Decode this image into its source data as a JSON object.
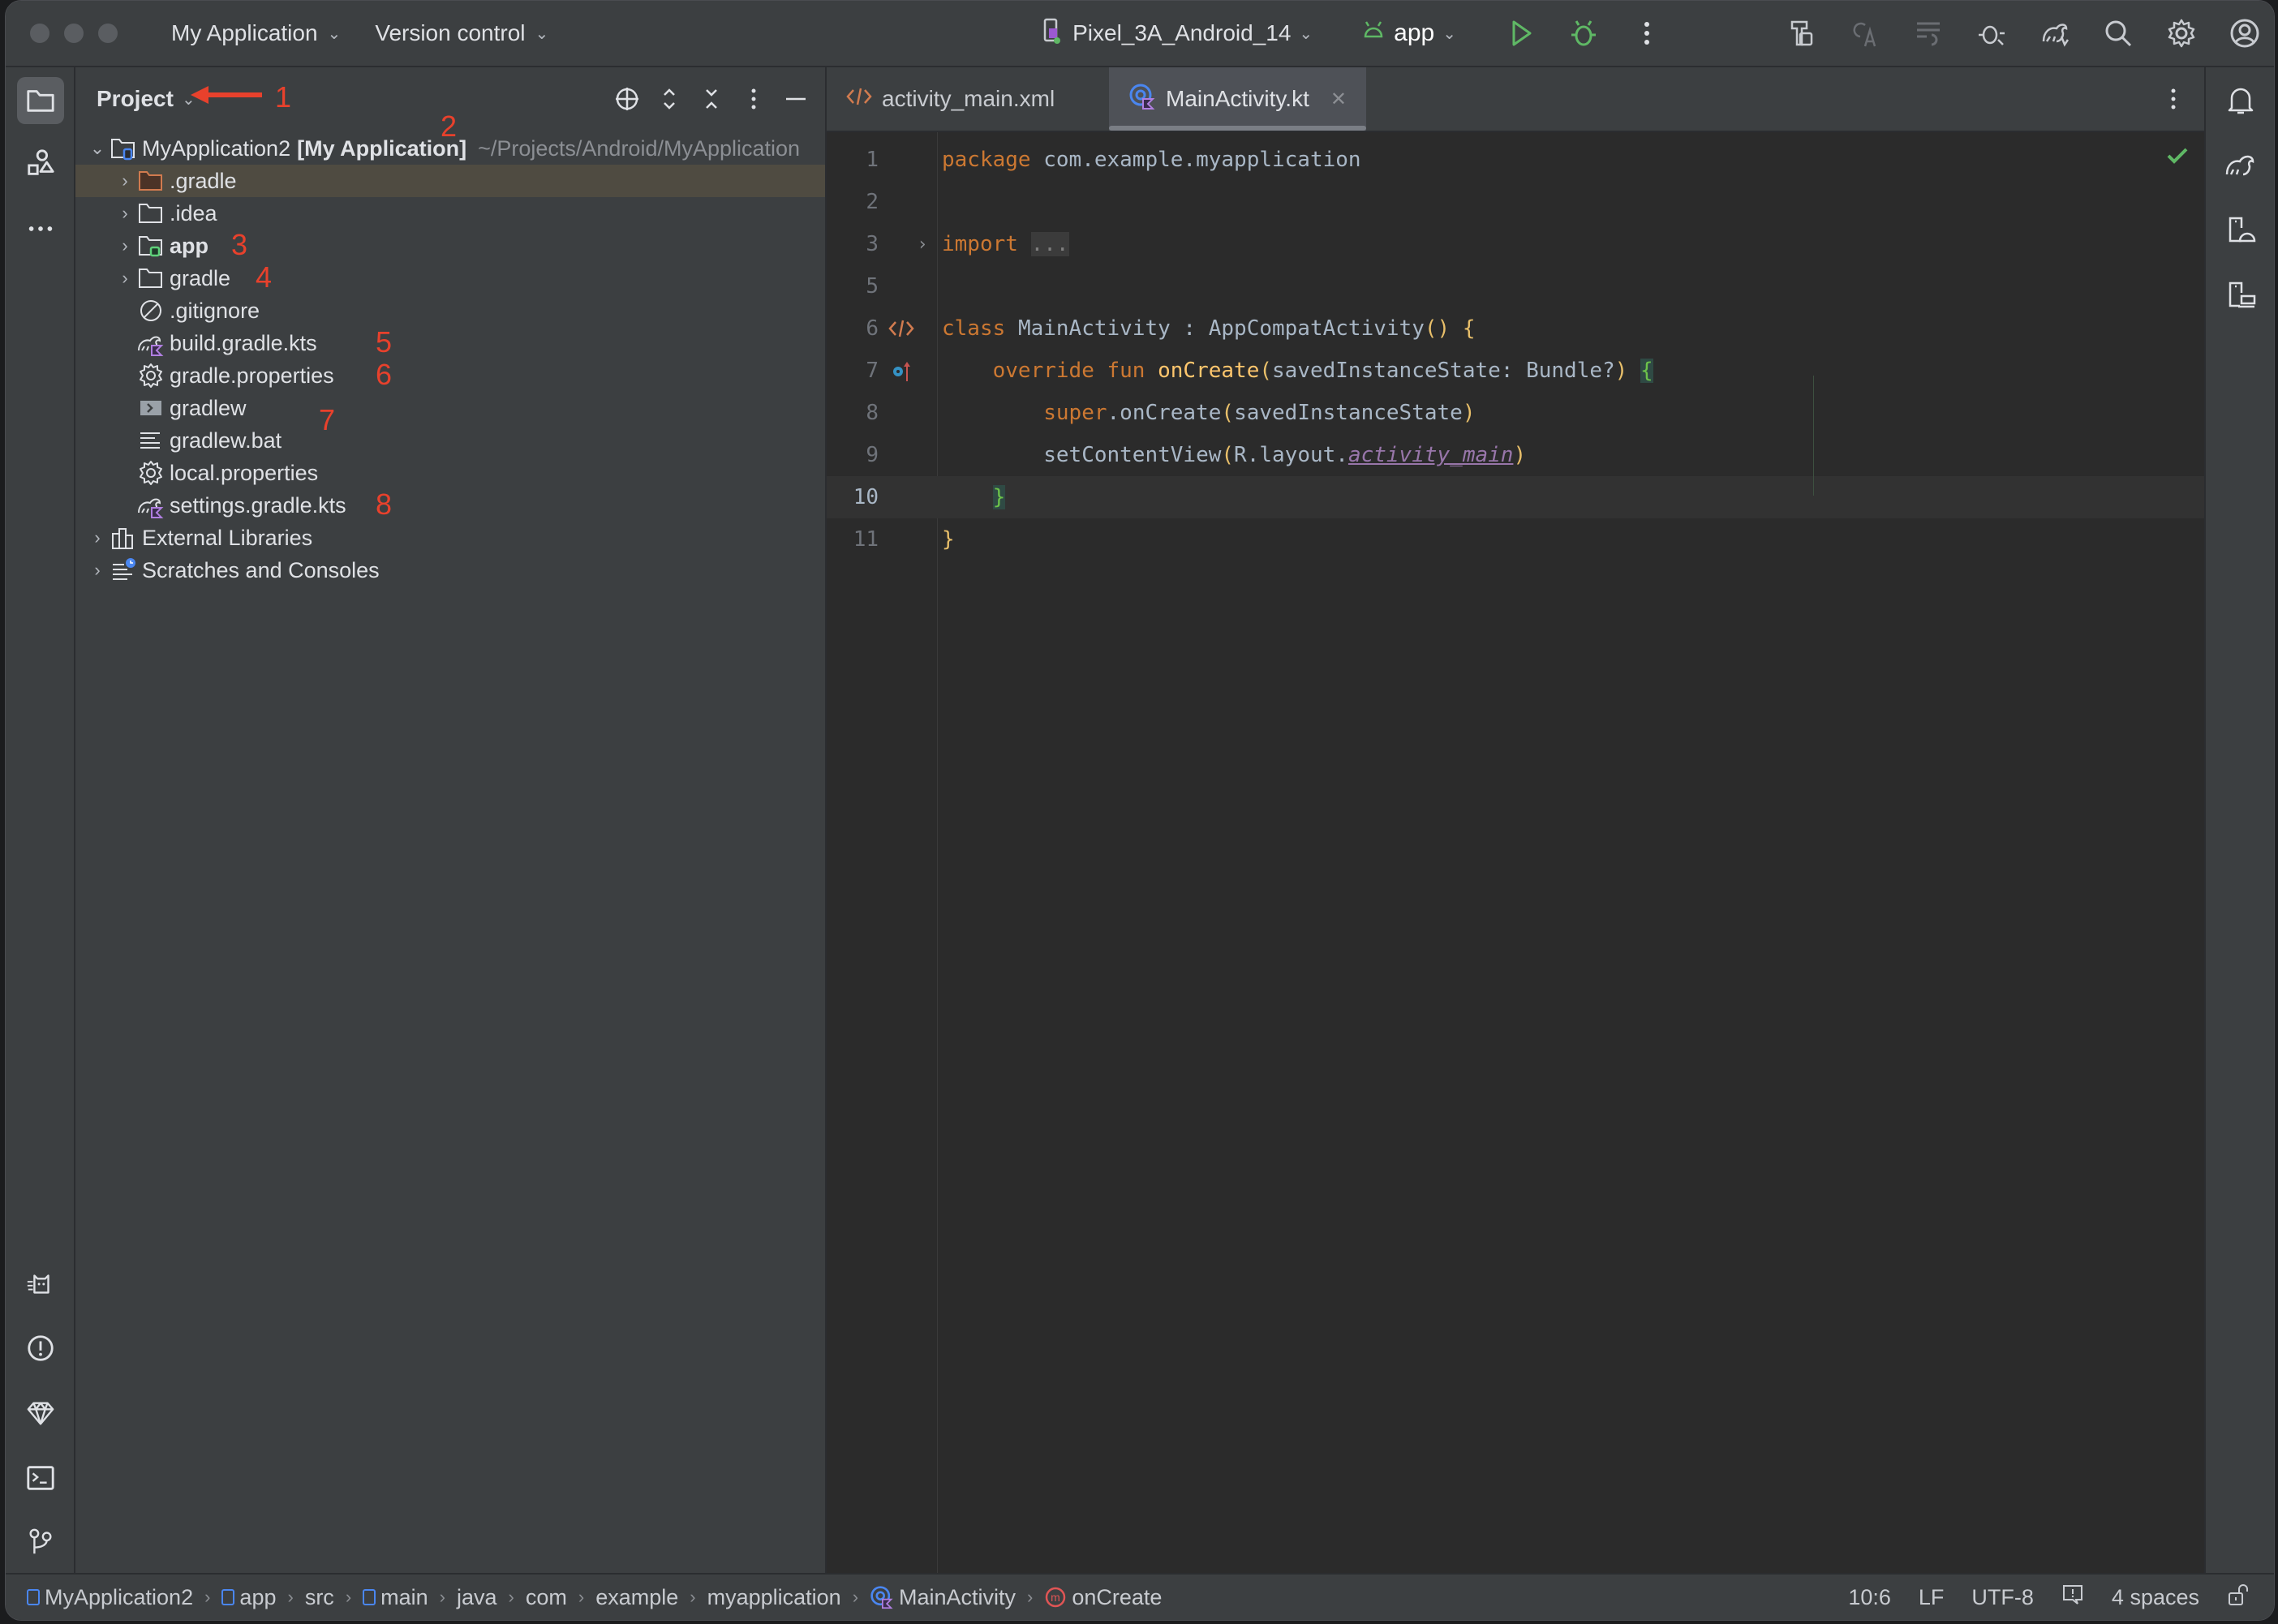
{
  "titlebar": {
    "project_menu": "My Application",
    "vcs_menu": "Version control",
    "device": "Pixel_3A_Android_14",
    "run_config": "app",
    "icons": [
      "run-icon",
      "debug-icon",
      "more-icon",
      "build-icon",
      "translate-icon",
      "sync-diff-icon",
      "profile-icon",
      "gradle-sync-icon",
      "search-icon",
      "settings-icon",
      "account-icon"
    ]
  },
  "left_strip": {
    "top": [
      "folder-icon",
      "structure-icon",
      "more-icon"
    ],
    "bottom": [
      "logcat-icon",
      "problems-icon",
      "gemini-icon",
      "terminal-icon",
      "git-icon"
    ]
  },
  "project_panel": {
    "title": "Project",
    "actions": [
      "locate-icon",
      "expand-all-icon",
      "collapse-all-icon",
      "options-icon",
      "hide-icon"
    ],
    "root": {
      "name": "MyApplication2",
      "module": "[My Application]",
      "path": "~/Projects/Android/MyApplication"
    },
    "items": [
      {
        "label": ".gradle",
        "icon": "folder-excluded",
        "expandable": true,
        "selected": true
      },
      {
        "label": ".idea",
        "icon": "folder",
        "expandable": true
      },
      {
        "label": "app",
        "icon": "module-folder",
        "expandable": true,
        "bold": true
      },
      {
        "label": "gradle",
        "icon": "folder",
        "expandable": true
      },
      {
        "label": ".gitignore",
        "icon": "ignore-file"
      },
      {
        "label": "build.gradle.kts",
        "icon": "gradle-kts"
      },
      {
        "label": "gradle.properties",
        "icon": "properties"
      },
      {
        "label": "gradlew",
        "icon": "shell-script"
      },
      {
        "label": "gradlew.bat",
        "icon": "text-file"
      },
      {
        "label": "local.properties",
        "icon": "properties"
      },
      {
        "label": "settings.gradle.kts",
        "icon": "gradle-kts"
      }
    ],
    "extras": [
      {
        "label": "External Libraries",
        "icon": "libraries"
      },
      {
        "label": "Scratches and Consoles",
        "icon": "scratches"
      }
    ]
  },
  "annotations": [
    "1",
    "2",
    "3",
    "4",
    "5",
    "6",
    "7",
    "8"
  ],
  "editor": {
    "tabs": [
      {
        "label": "activity_main.xml",
        "active": false
      },
      {
        "label": "MainActivity.kt",
        "active": true
      }
    ],
    "current_line": 10,
    "lines": [
      {
        "n": "1",
        "t": [
          [
            "kw",
            "package"
          ],
          [
            "",
            "com.example.myapplication"
          ]
        ]
      },
      {
        "n": "2",
        "t": []
      },
      {
        "n": "3",
        "t": [
          [
            "kw",
            "import"
          ],
          [
            "",
            "..."
          ]
        ]
      },
      {
        "n": "5",
        "t": []
      },
      {
        "n": "6",
        "t": [
          [
            "kw",
            "class"
          ],
          [
            "",
            "MainActivity : AppCompatActivity"
          ],
          [
            "paren",
            "()"
          ],
          [
            "brace-y",
            "{"
          ]
        ]
      },
      {
        "n": "7",
        "t": [
          [
            "kw",
            "override fun"
          ],
          [
            "fn",
            "onCreate"
          ],
          [
            "paren",
            "("
          ],
          [
            "",
            "savedInstanceState: Bundle?"
          ],
          [
            "paren",
            ")"
          ],
          [
            "brace-g",
            "{"
          ]
        ]
      },
      {
        "n": "8",
        "t": [
          [
            "kw",
            "super"
          ],
          [
            "",
            ".onCreate"
          ],
          [
            "paren",
            "("
          ],
          [
            "",
            "savedInstanceState"
          ],
          [
            "paren",
            ")"
          ]
        ]
      },
      {
        "n": "9",
        "t": [
          [
            "",
            "setContentView"
          ],
          [
            "paren",
            "("
          ],
          [
            "",
            "R.layout."
          ],
          [
            "ital",
            "activity_main"
          ],
          [
            "paren",
            ")"
          ]
        ]
      },
      {
        "n": "10",
        "t": [
          [
            "brace-g",
            "}"
          ]
        ]
      },
      {
        "n": "11",
        "t": [
          [
            "brace-y",
            "}"
          ]
        ]
      }
    ]
  },
  "right_strip": [
    "notifications-icon",
    "gradle-icon",
    "device-manager-icon",
    "running-devices-icon"
  ],
  "statusbar": {
    "breadcrumbs": [
      "MyApplication2",
      "app",
      "src",
      "main",
      "java",
      "com",
      "example",
      "myapplication",
      "MainActivity",
      "onCreate"
    ],
    "position": "10:6",
    "line_separator": "LF",
    "encoding": "UTF-8",
    "indent": "4 spaces"
  },
  "colors": {
    "keyword": "#cc7832",
    "function": "#ffc66d",
    "annotation_red": "#e8412c",
    "run_green": "#5fb865",
    "accent_blue": "#4a86f0",
    "kotlin_purple": "#b07fe0"
  }
}
